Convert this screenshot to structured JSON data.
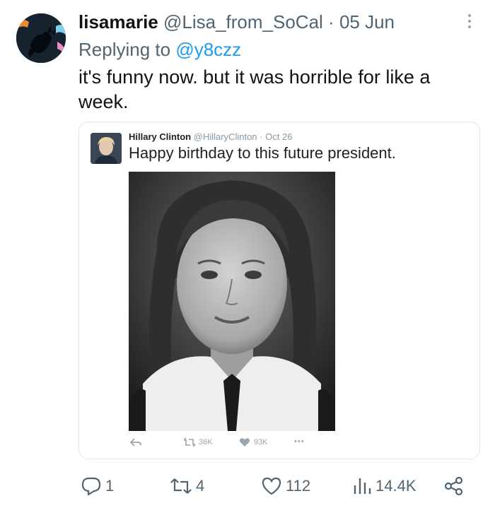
{
  "tweet": {
    "display_name": "lisamarie",
    "handle": "@Lisa_from_SoCal",
    "separator": "·",
    "date": "05 Jun",
    "reply_prefix": "Replying to",
    "reply_to": "@y8czz",
    "text": "it's funny now. but it was horrible for like a week.",
    "more_icon": "more-vertical-icon"
  },
  "embedded_tweet": {
    "display_name": "Hillary Clinton",
    "handle": "@HillaryClinton",
    "separator": "·",
    "date": "Oct 26",
    "text": "Happy birthday to this future president.",
    "actions": {
      "reply_icon": "reply-icon",
      "retweet_count": "36K",
      "like_count": "93K",
      "more_label": "•••"
    }
  },
  "actions": {
    "reply_count": "1",
    "retweet_count": "4",
    "like_count": "112",
    "views_count": "14.4K",
    "share_icon": "share-icon"
  },
  "colors": {
    "accent": "#1d9bf0",
    "secondary_text": "#536471",
    "primary_text": "#0f1419"
  }
}
